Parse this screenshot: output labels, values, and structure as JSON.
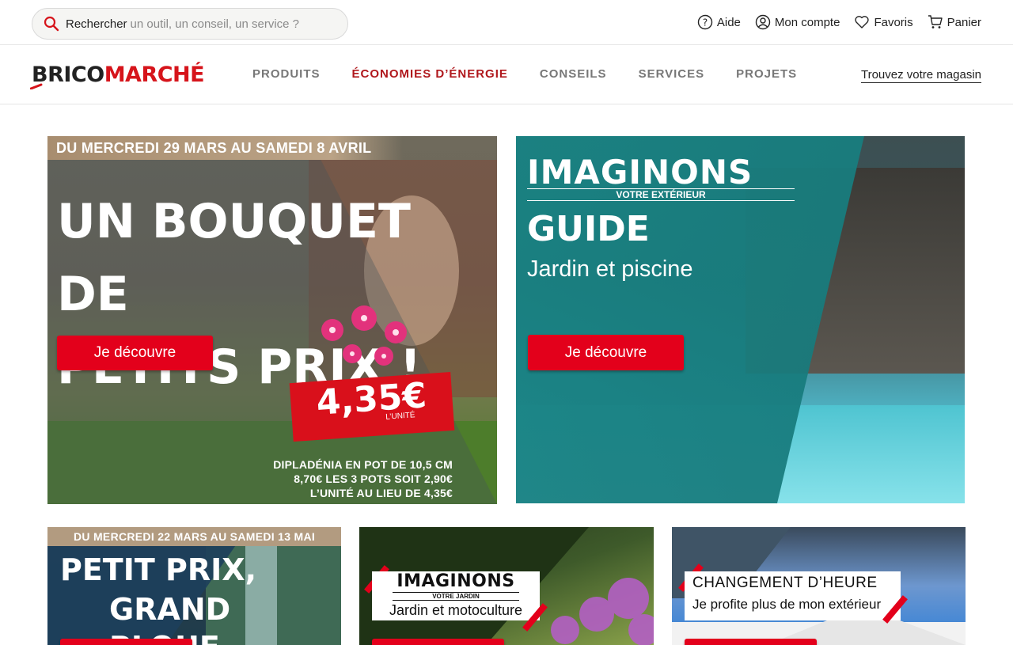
{
  "search": {
    "label": "Rechercher",
    "placeholder": "un outil, un conseil, un service ?"
  },
  "utility": {
    "help": "Aide",
    "account": "Mon compte",
    "favorites": "Favoris",
    "cart": "Panier"
  },
  "logo": {
    "part1": "BRICO",
    "part2": "MARCHÉ"
  },
  "nav": {
    "items": [
      {
        "label": "PRODUITS",
        "active": false
      },
      {
        "label": "ÉCONOMIES D’ÉNERGIE",
        "active": true
      },
      {
        "label": "CONSEILS",
        "active": false
      },
      {
        "label": "SERVICES",
        "active": false
      },
      {
        "label": "PROJETS",
        "active": false
      }
    ],
    "store_link": "Trouvez votre magasin"
  },
  "banners": {
    "b1": {
      "date": "DU MERCREDI 29 MARS AU SAMEDI 8 AVRIL",
      "title_line1": "UN BOUQUET DE",
      "title_line2": "PETITS PRIX !",
      "cta": "Je découvre",
      "price": "4,35€",
      "price_unit": "L’UNITÉ",
      "fine_line1": "DIPLADÉNIA EN POT DE 10,5 CM",
      "fine_line2": "8,70€ LES 3 POTS SOIT 2,90€",
      "fine_line3": "L’UNITÉ AU LIEU DE 4,35€"
    },
    "b2": {
      "brand": "IMAGINONS",
      "brand_sub": "VOTRE EXTÉRIEUR",
      "title": "GUIDE",
      "subtitle": "Jardin et piscine",
      "cta": "Je découvre"
    },
    "b3": {
      "date": "DU MERCREDI 22 MARS AU SAMEDI 13 MAI",
      "title_line1": "PETIT PRIX,",
      "title_line2": "GRAND PLOUF"
    },
    "b4": {
      "brand": "IMAGINONS",
      "brand_sub": "VOTRE JARDIN",
      "subtitle": "Jardin et motoculture"
    },
    "b5": {
      "title": "CHANGEMENT D’HEURE",
      "subtitle": "Je profite plus de mon extérieur"
    }
  },
  "colors": {
    "brand_red": "#e3001b",
    "active_nav": "#b0181d"
  }
}
